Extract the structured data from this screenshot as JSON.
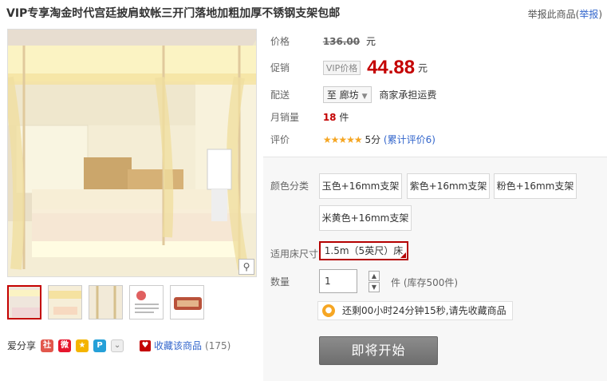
{
  "title": "VIP专享淘金时代宫廷披肩蚊帐三开门落地加粗加厚不锈钢支架包邮",
  "report": {
    "text": "举报此商品(",
    "link": "举报",
    "close": ")"
  },
  "price_row": {
    "label": "价格",
    "original": "136.00",
    "unit": "元"
  },
  "promo_row": {
    "label": "促销",
    "tag": "VIP价格",
    "price": "44.88",
    "unit": "元"
  },
  "ship_row": {
    "label": "配送",
    "location": "至 廊坊",
    "note": "商家承担运费"
  },
  "sales_row": {
    "label": "月销量",
    "count": "18",
    "unit": "件"
  },
  "rating_row": {
    "label": "评价",
    "stars": "★★★★★",
    "score": "5分",
    "link": "(累计评价6)"
  },
  "options": {
    "color_label": "颜色分类",
    "colors": [
      "玉色+16mm支架",
      "紫色+16mm支架",
      "粉色+16mm支架",
      "米黄色+16mm支架"
    ],
    "size_label": "适用床尺寸",
    "size_selected": "1.5m（5英尺）床",
    "qty_label": "数量",
    "qty_value": "1",
    "stock": "件  (库存500件)",
    "tip": "还剩00小时24分钟15秒,请先收藏商品",
    "buy_label": "即将开始"
  },
  "share": {
    "label": "爱分享",
    "fav_link": "收藏该商品",
    "fav_count": "(175)"
  },
  "colors": {
    "accent_red": "#c40000",
    "link_blue": "#3366cc",
    "button_gray": "#7a7a7a"
  },
  "icons": [
    "zoom-icon",
    "weibo-icon",
    "qzone-icon",
    "favorite-icon",
    "bulb-icon"
  ]
}
